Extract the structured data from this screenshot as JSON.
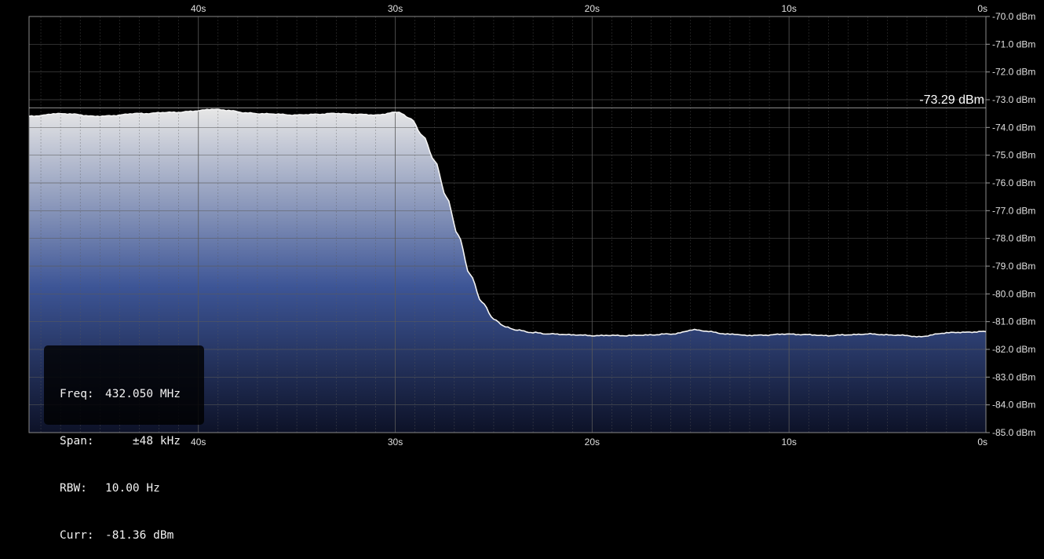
{
  "chart_data": {
    "type": "area",
    "x_unit": "s",
    "y_unit": "dBm",
    "x_axis": {
      "range": [
        48.6,
        0
      ],
      "reversed": true,
      "tick_values": [
        40,
        30,
        20,
        10,
        0
      ],
      "tick_labels": [
        "40s",
        "30s",
        "20s",
        "10s",
        "0s"
      ]
    },
    "y_axis": {
      "range": [
        -85.0,
        -70.0
      ],
      "position": "right",
      "tick_values": [
        -70,
        -71,
        -72,
        -73,
        -74,
        -75,
        -76,
        -77,
        -78,
        -79,
        -80,
        -81,
        -82,
        -83,
        -84,
        -85
      ],
      "tick_labels": [
        "-70.0 dBm",
        "-71.0 dBm",
        "-72.0 dBm",
        "-73.0 dBm",
        "-74.0 dBm",
        "-75.0 dBm",
        "-76.0 dBm",
        "-77.0 dBm",
        "-78.0 dBm",
        "-79.0 dBm",
        "-80.0 dBm",
        "-81.0 dBm",
        "-82.0 dBm",
        "-83.0 dBm",
        "-84.0 dBm",
        "-85.0 dBm"
      ]
    },
    "grid": true,
    "series": [
      {
        "x": [
          48.6,
          47,
          45,
          43,
          41,
          39.2,
          37,
          35,
          33,
          31,
          29.8,
          29.2,
          28.6,
          28.0,
          27.4,
          26.8,
          26.2,
          25.6,
          25.0,
          24.4,
          23.8,
          23.0,
          22.0,
          20,
          18,
          16,
          14.8,
          13,
          12,
          10,
          8,
          6,
          4,
          3.4,
          2,
          0
        ],
        "y": [
          -73.6,
          -73.5,
          -73.6,
          -73.5,
          -73.45,
          -73.35,
          -73.5,
          -73.55,
          -73.5,
          -73.55,
          -73.45,
          -73.7,
          -74.3,
          -75.2,
          -76.5,
          -77.9,
          -79.3,
          -80.3,
          -80.9,
          -81.2,
          -81.3,
          -81.4,
          -81.45,
          -81.5,
          -81.5,
          -81.45,
          -81.3,
          -81.45,
          -81.5,
          -81.45,
          -81.5,
          -81.45,
          -81.5,
          -81.55,
          -81.4,
          -81.36
        ]
      }
    ],
    "marker": {
      "value": -73.29,
      "label": "-73.29 dBm"
    }
  },
  "info": {
    "freq_label": "Freq:",
    "freq_value": "432.050 MHz",
    "span_label": "Span:",
    "span_value": "    ±48 kHz",
    "rbw_label": "RBW:",
    "rbw_value": "10.00 Hz",
    "curr_label": "Curr:",
    "curr_value": "-81.36 dBm"
  },
  "colors": {
    "background": "#000000",
    "grid": "#5a5a5a",
    "trace": "#f4f4f4",
    "fill_top": "#e6e6e6",
    "fill_mid": "#3d5596",
    "fill_bottom": "#0d1228"
  }
}
